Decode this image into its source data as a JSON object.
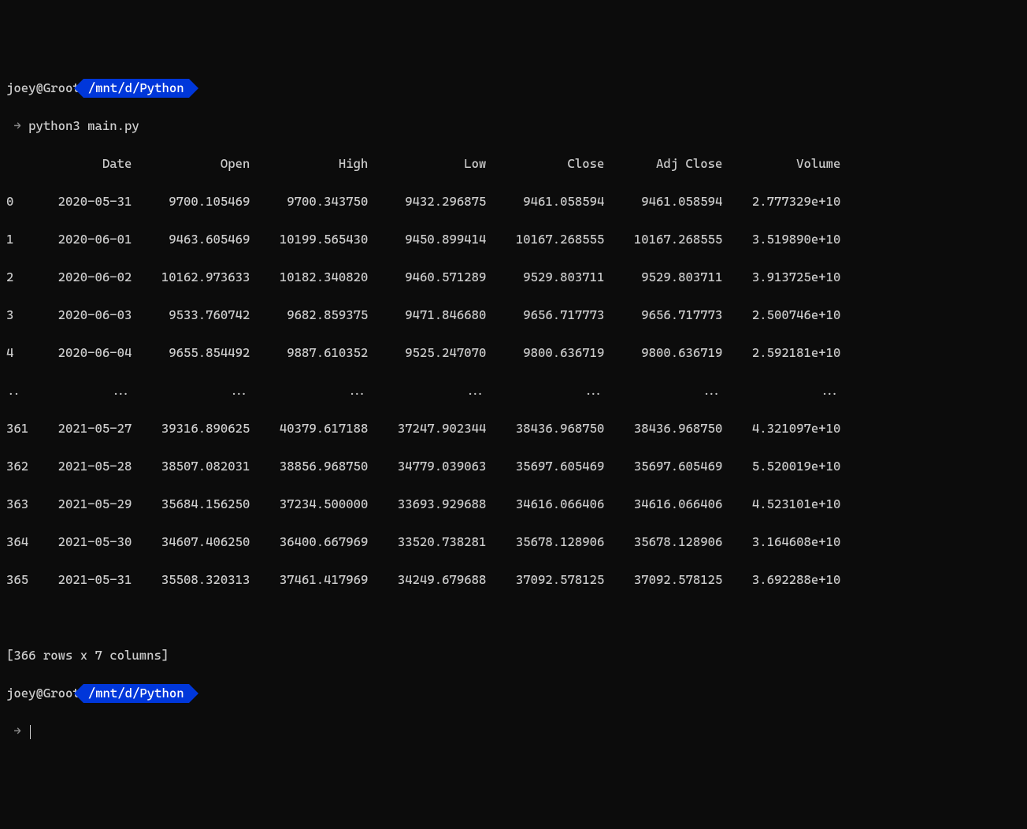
{
  "prompt1": {
    "user_host": "joey@Groot",
    "path": "/mnt/d/Python"
  },
  "command": "python3 main.py",
  "arrow": "→",
  "headers": [
    "Date",
    "Open",
    "High",
    "Low",
    "Close",
    "Adj Close",
    "Volume"
  ],
  "rows_top": [
    {
      "idx": "0",
      "Date": "2020-05-31",
      "Open": "9700.105469",
      "High": "9700.343750",
      "Low": "9432.296875",
      "Close": "9461.058594",
      "AdjClose": "9461.058594",
      "Volume": "2.777329e+10"
    },
    {
      "idx": "1",
      "Date": "2020-06-01",
      "Open": "9463.605469",
      "High": "10199.565430",
      "Low": "9450.899414",
      "Close": "10167.268555",
      "AdjClose": "10167.268555",
      "Volume": "3.519890e+10"
    },
    {
      "idx": "2",
      "Date": "2020-06-02",
      "Open": "10162.973633",
      "High": "10182.340820",
      "Low": "9460.571289",
      "Close": "9529.803711",
      "AdjClose": "9529.803711",
      "Volume": "3.913725e+10"
    },
    {
      "idx": "3",
      "Date": "2020-06-03",
      "Open": "9533.760742",
      "High": "9682.859375",
      "Low": "9471.846680",
      "Close": "9656.717773",
      "AdjClose": "9656.717773",
      "Volume": "2.500746e+10"
    },
    {
      "idx": "4",
      "Date": "2020-06-04",
      "Open": "9655.854492",
      "High": "9887.610352",
      "Low": "9525.247070",
      "Close": "9800.636719",
      "AdjClose": "9800.636719",
      "Volume": "2.592181e+10"
    }
  ],
  "ellipsis": {
    "idx": "..",
    "cell": "..."
  },
  "rows_bottom": [
    {
      "idx": "361",
      "Date": "2021-05-27",
      "Open": "39316.890625",
      "High": "40379.617188",
      "Low": "37247.902344",
      "Close": "38436.968750",
      "AdjClose": "38436.968750",
      "Volume": "4.321097e+10"
    },
    {
      "idx": "362",
      "Date": "2021-05-28",
      "Open": "38507.082031",
      "High": "38856.968750",
      "Low": "34779.039063",
      "Close": "35697.605469",
      "AdjClose": "35697.605469",
      "Volume": "5.520019e+10"
    },
    {
      "idx": "363",
      "Date": "2021-05-29",
      "Open": "35684.156250",
      "High": "37234.500000",
      "Low": "33693.929688",
      "Close": "34616.066406",
      "AdjClose": "34616.066406",
      "Volume": "4.523101e+10"
    },
    {
      "idx": "364",
      "Date": "2021-05-30",
      "Open": "34607.406250",
      "High": "36400.667969",
      "Low": "33520.738281",
      "Close": "35678.128906",
      "AdjClose": "35678.128906",
      "Volume": "3.164608e+10"
    },
    {
      "idx": "365",
      "Date": "2021-05-31",
      "Open": "35508.320313",
      "High": "37461.417969",
      "Low": "34249.679688",
      "Close": "37092.578125",
      "AdjClose": "37092.578125",
      "Volume": "3.692288e+10"
    }
  ],
  "summary": "[366 rows x 7 columns]",
  "prompt2": {
    "user_host": "joey@Groot",
    "path": "/mnt/d/Python"
  }
}
